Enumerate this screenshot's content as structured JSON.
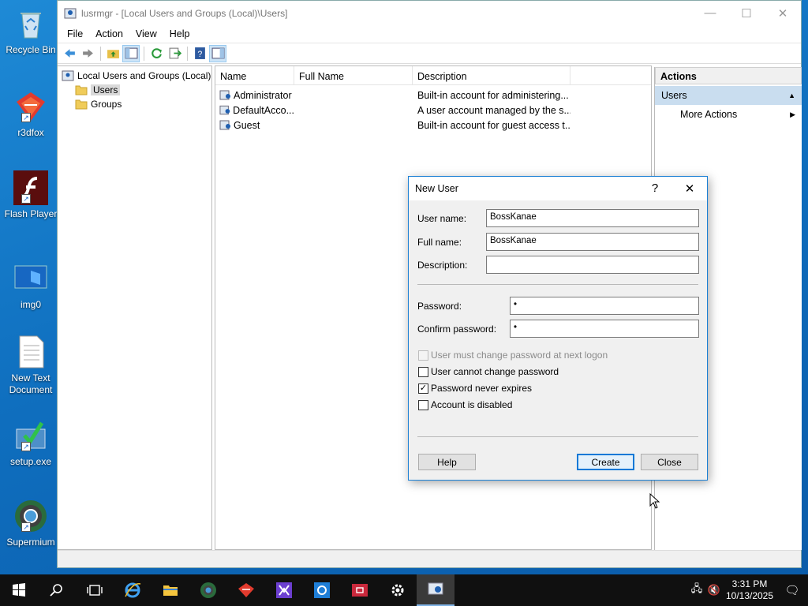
{
  "desktop": {
    "icons": [
      {
        "label": "Recycle Bin",
        "icon": "recycle-bin-icon"
      },
      {
        "label": "r3dfox",
        "icon": "r3dfox-icon"
      },
      {
        "label": "Flash Player",
        "icon": "flash-player-icon"
      },
      {
        "label": "img0",
        "icon": "image-file-icon"
      },
      {
        "label": "New Text Document",
        "icon": "text-document-icon"
      },
      {
        "label": "setup.exe",
        "icon": "setup-exe-icon"
      },
      {
        "label": "Supermium",
        "icon": "supermium-icon"
      }
    ]
  },
  "window": {
    "title": "lusrmgr - [Local Users and Groups (Local)\\Users]",
    "menu": [
      "File",
      "Action",
      "View",
      "Help"
    ],
    "tree": {
      "root": "Local Users and Groups (Local)",
      "children": [
        "Users",
        "Groups"
      ],
      "selected": "Users"
    },
    "list": {
      "columns": [
        "Name",
        "Full Name",
        "Description"
      ],
      "rows": [
        {
          "name": "Administrator",
          "full_name": "",
          "description": "Built-in account for administering..."
        },
        {
          "name": "DefaultAcco...",
          "full_name": "",
          "description": "A user account managed by the s..."
        },
        {
          "name": "Guest",
          "full_name": "",
          "description": "Built-in account for guest access t..."
        }
      ]
    },
    "actions": {
      "header": "Actions",
      "group": "Users",
      "item": "More Actions"
    }
  },
  "dialog": {
    "title": "New User",
    "help_glyph": "?",
    "close_glyph": "✕",
    "labels": {
      "username": "User name:",
      "fullname": "Full name:",
      "description": "Description:",
      "password": "Password:",
      "confirm": "Confirm password:"
    },
    "values": {
      "username": "BossKanae",
      "fullname": "BossKanae",
      "description": "",
      "password": "•",
      "confirm": "•"
    },
    "checkboxes": [
      {
        "label": "User must change password at next logon",
        "checked": false,
        "disabled": true
      },
      {
        "label": "User cannot change password",
        "checked": false,
        "disabled": false
      },
      {
        "label": "Password never expires",
        "checked": true,
        "disabled": false
      },
      {
        "label": "Account is disabled",
        "checked": false,
        "disabled": false
      }
    ],
    "buttons": {
      "help": "Help",
      "create": "Create",
      "close": "Close"
    }
  },
  "taskbar": {
    "time": "3:31 PM",
    "date": "10/13/2025"
  }
}
